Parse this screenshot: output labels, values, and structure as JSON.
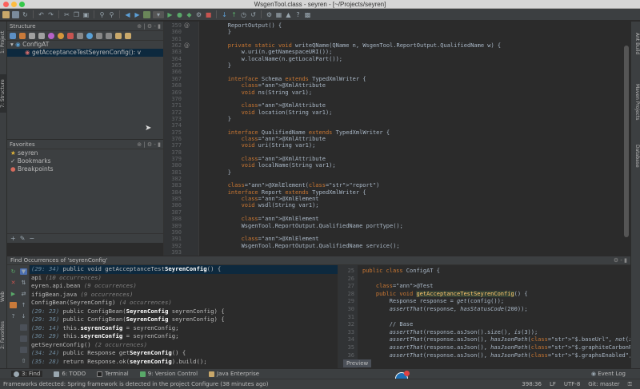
{
  "window": {
    "title": "WsgenTool.class - seyren - [~/Projects/seyren]"
  },
  "left_strip": {
    "project": "1: Project",
    "structure": "7: Structure",
    "web": "Web",
    "favorites": "2: Favorites"
  },
  "right_strip": {
    "ant": "Ant Build",
    "maven": "Maven Projects",
    "database": "Database"
  },
  "structure": {
    "title": "Structure",
    "tree": [
      {
        "label": "ConfigAT",
        "selected": false
      },
      {
        "label": "getAcceptanceTestSeyrenConfig(): v",
        "selected": true
      }
    ]
  },
  "favorites": {
    "title": "Favorites",
    "items": [
      "seyren",
      "Bookmarks",
      "Breakpoints"
    ]
  },
  "editor": {
    "lines": [
      {
        "n": "359",
        "t": "        ReportOutput() {"
      },
      {
        "n": "360",
        "t": "        }"
      },
      {
        "n": "361",
        "t": ""
      },
      {
        "n": "362",
        "t": "        private static void writeQName(QName n, WsgenTool.ReportOutput.QualifiedName w) {"
      },
      {
        "n": "363",
        "t": "            w.uri(n.getNamespaceURI());"
      },
      {
        "n": "364",
        "t": "            w.localName(n.getLocalPart());"
      },
      {
        "n": "365",
        "t": "        }"
      },
      {
        "n": "366",
        "t": ""
      },
      {
        "n": "367",
        "t": "        interface Schema extends TypedXmlWriter {"
      },
      {
        "n": "368",
        "t": "            @XmlAttribute"
      },
      {
        "n": "369",
        "t": "            void ns(String var1);"
      },
      {
        "n": "370",
        "t": ""
      },
      {
        "n": "371",
        "t": "            @XmlAttribute"
      },
      {
        "n": "372",
        "t": "            void location(String var1);"
      },
      {
        "n": "373",
        "t": "        }"
      },
      {
        "n": "374",
        "t": ""
      },
      {
        "n": "375",
        "t": "        interface QualifiedName extends TypedXmlWriter {"
      },
      {
        "n": "376",
        "t": "            @XmlAttribute"
      },
      {
        "n": "377",
        "t": "            void uri(String var1);"
      },
      {
        "n": "378",
        "t": ""
      },
      {
        "n": "379",
        "t": "            @XmlAttribute"
      },
      {
        "n": "380",
        "t": "            void localName(String var1);"
      },
      {
        "n": "381",
        "t": "        }"
      },
      {
        "n": "382",
        "t": ""
      },
      {
        "n": "383",
        "t": "        @XmlElement(\"report\")"
      },
      {
        "n": "384",
        "t": "        interface Report extends TypedXmlWriter {"
      },
      {
        "n": "385",
        "t": "            @XmlElement"
      },
      {
        "n": "386",
        "t": "            void wsdl(String var1);"
      },
      {
        "n": "387",
        "t": ""
      },
      {
        "n": "388",
        "t": "            @XmlElement"
      },
      {
        "n": "389",
        "t": "            WsgenTool.ReportOutput.QualifiedName portType();"
      },
      {
        "n": "390",
        "t": ""
      },
      {
        "n": "391",
        "t": "            @XmlElement"
      },
      {
        "n": "392",
        "t": "            WsgenTool.ReportOutput.QualifiedName service();"
      },
      {
        "n": "393",
        "t": ""
      }
    ]
  },
  "find": {
    "title": "Find Occurrences of 'seyrenConfig'",
    "rows": [
      {
        "loc": "(29: 34)",
        "pre": " public void getAcceptanceTest",
        "b": "SeyrenConfig",
        "post": "() {",
        "occ": "",
        "sel": true
      },
      {
        "loc": "",
        "pre": "api ",
        "b": "",
        "post": "",
        "occ": "(10 occurrences)",
        "sel": false
      },
      {
        "loc": "",
        "pre": "eyren.api.bean ",
        "b": "",
        "post": "",
        "occ": "(9 occurrences)",
        "sel": false
      },
      {
        "loc": "",
        "pre": "ifigBean.java ",
        "b": "",
        "post": "",
        "occ": "(9 occurrences)",
        "sel": false
      },
      {
        "loc": "",
        "pre": "ConfigBean(SeyrenConfig) ",
        "b": "",
        "post": "",
        "occ": "(4 occurrences)",
        "sel": false
      },
      {
        "loc": "(29: 23)",
        "pre": " public ConfigBean(",
        "b": "SeyrenConfig",
        "post": " seyrenConfig) {",
        "occ": "",
        "sel": false
      },
      {
        "loc": "(29: 36)",
        "pre": " public ConfigBean(",
        "b": "SeyrenConfig",
        "post": " seyrenConfig) {",
        "occ": "",
        "sel": false
      },
      {
        "loc": "(30: 14)",
        "pre": " this.",
        "b": "seyrenConfig",
        "post": " = seyrenConfig;",
        "occ": "",
        "sel": false
      },
      {
        "loc": "(30: 29)",
        "pre": " this.",
        "b": "seyrenConfig",
        "post": " = seyrenConfig;",
        "occ": "",
        "sel": false
      },
      {
        "loc": "",
        "pre": "getSeyrenConfig() ",
        "b": "",
        "post": "",
        "occ": "(2 occurrences)",
        "sel": false
      },
      {
        "loc": "(34: 24)",
        "pre": " public Response get",
        "b": "SeyrenConfig",
        "post": "() {",
        "occ": "",
        "sel": false
      },
      {
        "loc": "(35: 28)",
        "pre": " return Response.ok(",
        "b": "seyrenConfig",
        "post": ").build();",
        "occ": "",
        "sel": false
      }
    ],
    "preview_tab": "Preview"
  },
  "preview": {
    "lines": [
      {
        "n": "25",
        "t": "public class ConfigAT {"
      },
      {
        "n": "26",
        "t": ""
      },
      {
        "n": "27",
        "t": "    @Test"
      },
      {
        "n": "28",
        "t": "    public void getAcceptanceTestSeyrenConfig() {"
      },
      {
        "n": "29",
        "t": "        Response response = get(config());"
      },
      {
        "n": "30",
        "t": "        assertThat(response, hasStatusCode(200));"
      },
      {
        "n": "31",
        "t": ""
      },
      {
        "n": "32",
        "t": "        // Base"
      },
      {
        "n": "33",
        "t": "        assertThat(response.asJson().size(), is(3));"
      },
      {
        "n": "34",
        "t": "        assertThat(response.asJson(), hasJsonPath(\"$.baseUrl\", not(isEmptyOrNullString())));"
      },
      {
        "n": "35",
        "t": "        assertThat(response.asJson(), hasJsonPath(\"$.graphiteCarbonPickleEnabled\", is(false)));"
      },
      {
        "n": "36",
        "t": "        assertThat(response.asJson(), hasJsonPath(\"$.graphsEnabled\", is(true)));"
      }
    ]
  },
  "bottom_tabs": {
    "find": "3: Find",
    "todo": "6: TODO",
    "terminal": "Terminal",
    "vcs": "9: Version Control",
    "javaee": "Java Enterprise",
    "event_log": "Event Log"
  },
  "status": {
    "message": "Frameworks detected: Spring framework is detected in the project Configure (38 minutes ago)",
    "position": "398:36",
    "line_sep": "LF",
    "encoding": "UTF-8",
    "git": "Git: master"
  },
  "colors": {
    "accent": "#0d293e",
    "keyword": "#cc7832",
    "annotation": "#bbb529"
  }
}
